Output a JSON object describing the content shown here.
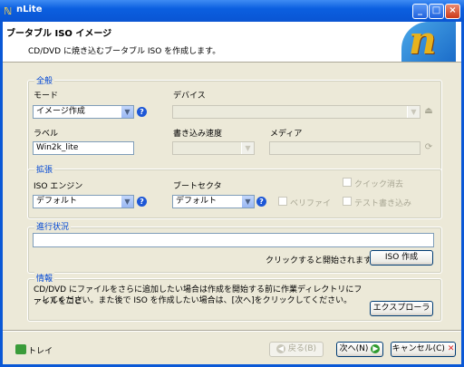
{
  "window": {
    "title": "nLite"
  },
  "header": {
    "title": "ブータブル ISO イメージ",
    "subtitle": "CD/DVD に焼き込むブータブル ISO を作成します。"
  },
  "general": {
    "group_label": "全般",
    "mode_label": "モード",
    "mode_value": "イメージ作成",
    "device_label": "デバイス",
    "device_value": "",
    "label_label": "ラベル",
    "label_value": "Win2k_lite",
    "write_speed_label": "書き込み速度",
    "write_speed_value": "",
    "media_label": "メディア",
    "media_value": ""
  },
  "advanced": {
    "group_label": "拡張",
    "iso_engine_label": "ISO エンジン",
    "iso_engine_value": "デフォルト",
    "boot_sector_label": "ブートセクタ",
    "boot_sector_value": "デフォルト",
    "quick_erase_label": "クイック消去",
    "verify_label": "ベリファイ",
    "test_write_label": "テスト書き込み"
  },
  "progress": {
    "group_label": "進行状況",
    "hint": "クリックすると開始されます ->",
    "create_button": "ISO 作成"
  },
  "info": {
    "group_label": "情報",
    "text_line1": "CD/DVD にファイルをさらに追加したい場合は作成を開始する前に作業ディレクトリにファイルをコピ",
    "text_line2": "ーしてください。また後で ISO を作成したい場合は、[次へ]をクリックしてください。",
    "explorer_button": "エクスプローラ"
  },
  "footer": {
    "tray_label": "トレイ",
    "back_button": "戻る(B)",
    "next_button": "次へ(N)",
    "cancel_button": "キャンセル(C)"
  },
  "colors": {
    "titlebar": "#0a55d3",
    "group_label": "#0046d5",
    "dialog_bg": "#ece9d8"
  }
}
